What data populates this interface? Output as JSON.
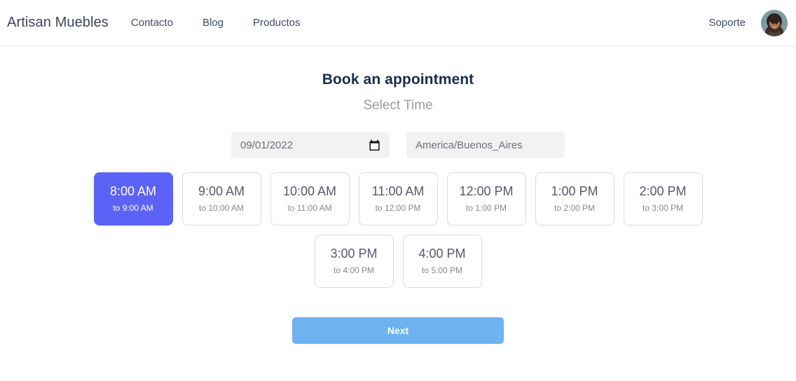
{
  "header": {
    "brand": "Artisan Muebles",
    "nav_items": [
      {
        "label": "Contacto"
      },
      {
        "label": "Blog"
      },
      {
        "label": "Productos"
      }
    ],
    "support_label": "Soporte",
    "avatar_icon": "user-avatar-photo"
  },
  "booking": {
    "title": "Book an appointment",
    "subtitle": "Select Time",
    "date": {
      "value": "09/01/2022",
      "icon": "calendar-icon"
    },
    "timezone": {
      "value": "America/Buenos_Aires"
    },
    "slots": [
      {
        "time": "8:00 AM",
        "range": "to 9:00 AM",
        "selected": true
      },
      {
        "time": "9:00 AM",
        "range": "to 10:00 AM",
        "selected": false
      },
      {
        "time": "10:00 AM",
        "range": "to 11:00 AM",
        "selected": false
      },
      {
        "time": "11:00 AM",
        "range": "to 12:00 PM",
        "selected": false
      },
      {
        "time": "12:00 PM",
        "range": "to 1:00 PM",
        "selected": false
      },
      {
        "time": "1:00 PM",
        "range": "to 2:00 PM",
        "selected": false
      },
      {
        "time": "2:00 PM",
        "range": "to 3:00 PM",
        "selected": false
      },
      {
        "time": "3:00 PM",
        "range": "to 4:00 PM",
        "selected": false
      },
      {
        "time": "4:00 PM",
        "range": "to 5:00 PM",
        "selected": false
      }
    ],
    "next_label": "Next"
  },
  "colors": {
    "selected_slot": "#5c62f5",
    "next_button": "#6cb3f0",
    "title": "#1d2b4b",
    "subtitle": "#9b9ba5",
    "input_bg": "#f2f2f3"
  }
}
